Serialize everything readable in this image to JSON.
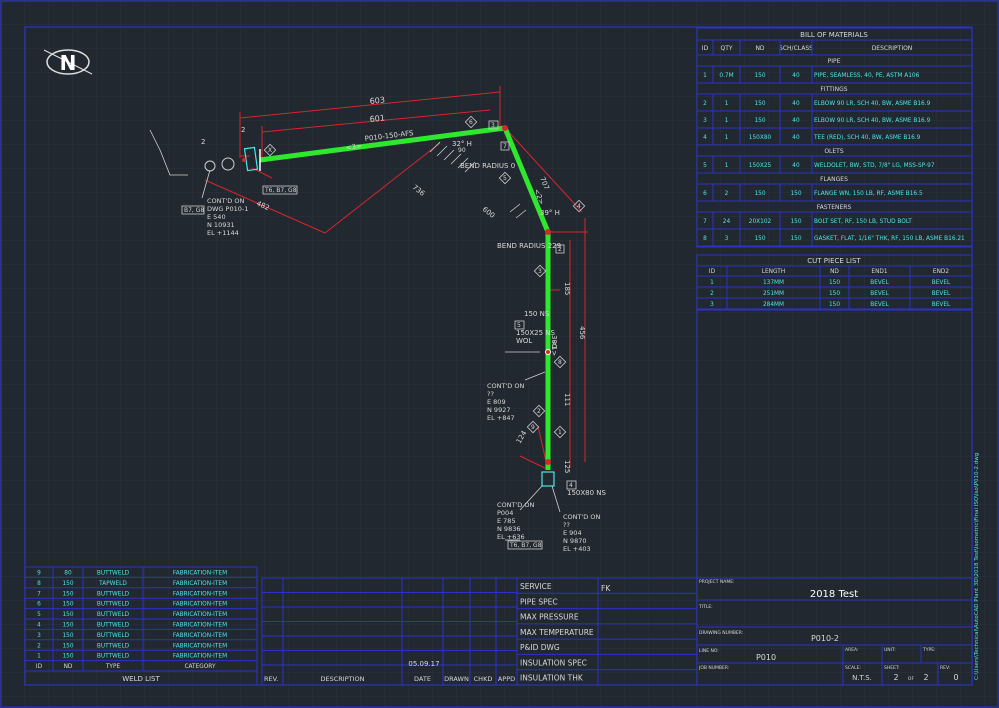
{
  "colors": {
    "background": "#212830",
    "frame": "#2b32c8",
    "pipe": "#2ee82e",
    "dim": "#d7262b",
    "cyan": "#4ee6e6",
    "text": "#d9d9d9"
  },
  "north_label": "N",
  "bom": {
    "title": "BILL OF MATERIALS",
    "headers": [
      "ID",
      "QTY",
      "ND",
      "SCH/CLASS",
      "DESCRIPTION"
    ],
    "groups": [
      {
        "name": "PIPE",
        "rows": [
          [
            "1",
            "0.7M",
            "150",
            "40",
            "PIPE, SEAMLESS, 40, PE, ASTM A106"
          ]
        ]
      },
      {
        "name": "FITTINGS",
        "rows": [
          [
            "2",
            "1",
            "150",
            "40",
            "ELBOW 90 LR, SCH 40, BW, ASME B16.9"
          ],
          [
            "3",
            "1",
            "150",
            "40",
            "ELBOW 90 LR, SCH 40, BW, ASME B16.9"
          ],
          [
            "4",
            "1",
            "150X80",
            "40",
            "TEE (RED), SCH 40, BW, ASME B16.9"
          ]
        ]
      },
      {
        "name": "OLETS",
        "rows": [
          [
            "5",
            "1",
            "150X25",
            "40",
            "WELDOLET, BW, STD, 7/8\" LG, MSS-SP-97"
          ]
        ]
      },
      {
        "name": "FLANGES",
        "rows": [
          [
            "6",
            "2",
            "150",
            "150",
            "FLANGE WN, 150 LB, RF, ASME B16.5"
          ]
        ]
      },
      {
        "name": "FASTENERS",
        "rows": [
          [
            "7",
            "24",
            "20X102",
            "150",
            "BOLT SET, RF, 150 LB, STUD BOLT"
          ],
          [
            "8",
            "3",
            "150",
            "150",
            "GASKET, FLAT, 1/16\" THK, RF, 150 LB, ASME B16.21"
          ]
        ]
      }
    ]
  },
  "cut_list": {
    "title": "CUT PIECE LIST",
    "headers": [
      "ID",
      "LENGTH",
      "ND",
      "END1",
      "END2"
    ],
    "rows": [
      [
        "1",
        "137MM",
        "150",
        "BEVEL",
        "BEVEL"
      ],
      [
        "2",
        "251MM",
        "150",
        "BEVEL",
        "BEVEL"
      ],
      [
        "3",
        "284MM",
        "150",
        "BEVEL",
        "BEVEL"
      ]
    ]
  },
  "weld_list": {
    "title": "WELD LIST",
    "headers": [
      "ID",
      "ND",
      "TYPE",
      "CATEGORY"
    ],
    "rows": [
      [
        "9",
        "80",
        "BUTTWELD",
        "FABRICATION-ITEM"
      ],
      [
        "8",
        "150",
        "TAPWELD",
        "FABRICATION-ITEM"
      ],
      [
        "7",
        "150",
        "BUTTWELD",
        "FABRICATION-ITEM"
      ],
      [
        "6",
        "150",
        "BUTTWELD",
        "FABRICATION-ITEM"
      ],
      [
        "5",
        "150",
        "BUTTWELD",
        "FABRICATION-ITEM"
      ],
      [
        "4",
        "150",
        "BUTTWELD",
        "FABRICATION-ITEM"
      ],
      [
        "3",
        "150",
        "BUTTWELD",
        "FABRICATION-ITEM"
      ],
      [
        "2",
        "150",
        "BUTTWELD",
        "FABRICATION-ITEM"
      ],
      [
        "1",
        "150",
        "BUTTWELD",
        "FABRICATION-ITEM"
      ]
    ]
  },
  "revision": {
    "headers": [
      "REV.",
      "DESCRIPTION",
      "DATE",
      "DRAWN",
      "CHKD",
      "APPD"
    ],
    "date": "05.09.17"
  },
  "spec_labels": [
    "SERVICE",
    "PIPE SPEC",
    "MAX PRESSURE",
    "MAX TEMPERATURE",
    "P&ID DWG",
    "INSULATION SPEC",
    "INSULATION THK"
  ],
  "service_value": "FK",
  "title_block": {
    "project_name_label": "PROJECT NAME:",
    "project_name": "2018 Test",
    "title_label": "TITLE:",
    "drawing_number_label": "DRAWING NUMBER:",
    "drawing_number": "P010-2",
    "line_no_label": "LINE NO:",
    "line_no": "P010",
    "area_label": "AREA:",
    "unit_label": "UNIT:",
    "type_label": "TYPE:",
    "job_number_label": "JOB NUMBER:",
    "scale_label": "SCALE:",
    "scale": "N.T.S.",
    "sheet_label": "SHEET:",
    "sheet": "2",
    "of": "OF",
    "sheets": "2",
    "rev_label": "REV:",
    "rev": "0"
  },
  "side_path": "C:\\Users\\Technical\\AutoCAD Plant 3D\\2018 Test\\Isometric\\Final ISO\\Iso\\P010-2.dwg",
  "annotations": {
    "dim_603": "603",
    "dim_601": "601",
    "line_tag": "P010-150-AFS",
    "dim_707": "707",
    "dim_736": "736",
    "dim_482": "482",
    "dim_600": "600",
    "angle_32": "32° H",
    "angle_39": "39° H",
    "dim_90": "90",
    "bend_radius_top": "BEND RADIUS 0",
    "bend_radius_mid": "BEND RADIUS 229",
    "dim_185": "185",
    "dim_456": "456",
    "dim_300": "300",
    "dim_111": "111",
    "dim_124": "124",
    "dim_125": "125",
    "nozzle_150": "150 NS",
    "wol_1": "150X25 NS",
    "wol_2": "WOL",
    "branch_size": "150X80 NS",
    "fab_ref_a": "T6, B7, G8",
    "fab_ref_b": "B7, G8",
    "fab_ref_c": "T6, B7, G8",
    "box_3": "3",
    "box_5": "5",
    "box_4": "4",
    "dim_2a": "2",
    "dim_2b": "2",
    "b_1": "1",
    "b_2": "2",
    "b_3": "3",
    "b_4": "4",
    "b_5": "5",
    "b_6": "6",
    "b_7": "7",
    "b_8": "8",
    "b_9": "9",
    "b_x": "X",
    "pipe_lbl_a": "<1>",
    "pipe_lbl_b": "<2>",
    "pipe_lbl_c": "<3>",
    "cont_left": [
      "CONT'D ON",
      "DWG P010-1",
      "E 540",
      "N 10931",
      "EL +1144"
    ],
    "cont_mid": [
      "CONT'D ON",
      "??",
      "E 809",
      "N 9927",
      "EL +847"
    ],
    "cont_bl": [
      "CONT'D ON",
      "P004",
      "E 785",
      "N 9836",
      "EL +636"
    ],
    "cont_br": [
      "CONT'D ON",
      "??",
      "E 904",
      "N 9870",
      "EL +403"
    ]
  }
}
